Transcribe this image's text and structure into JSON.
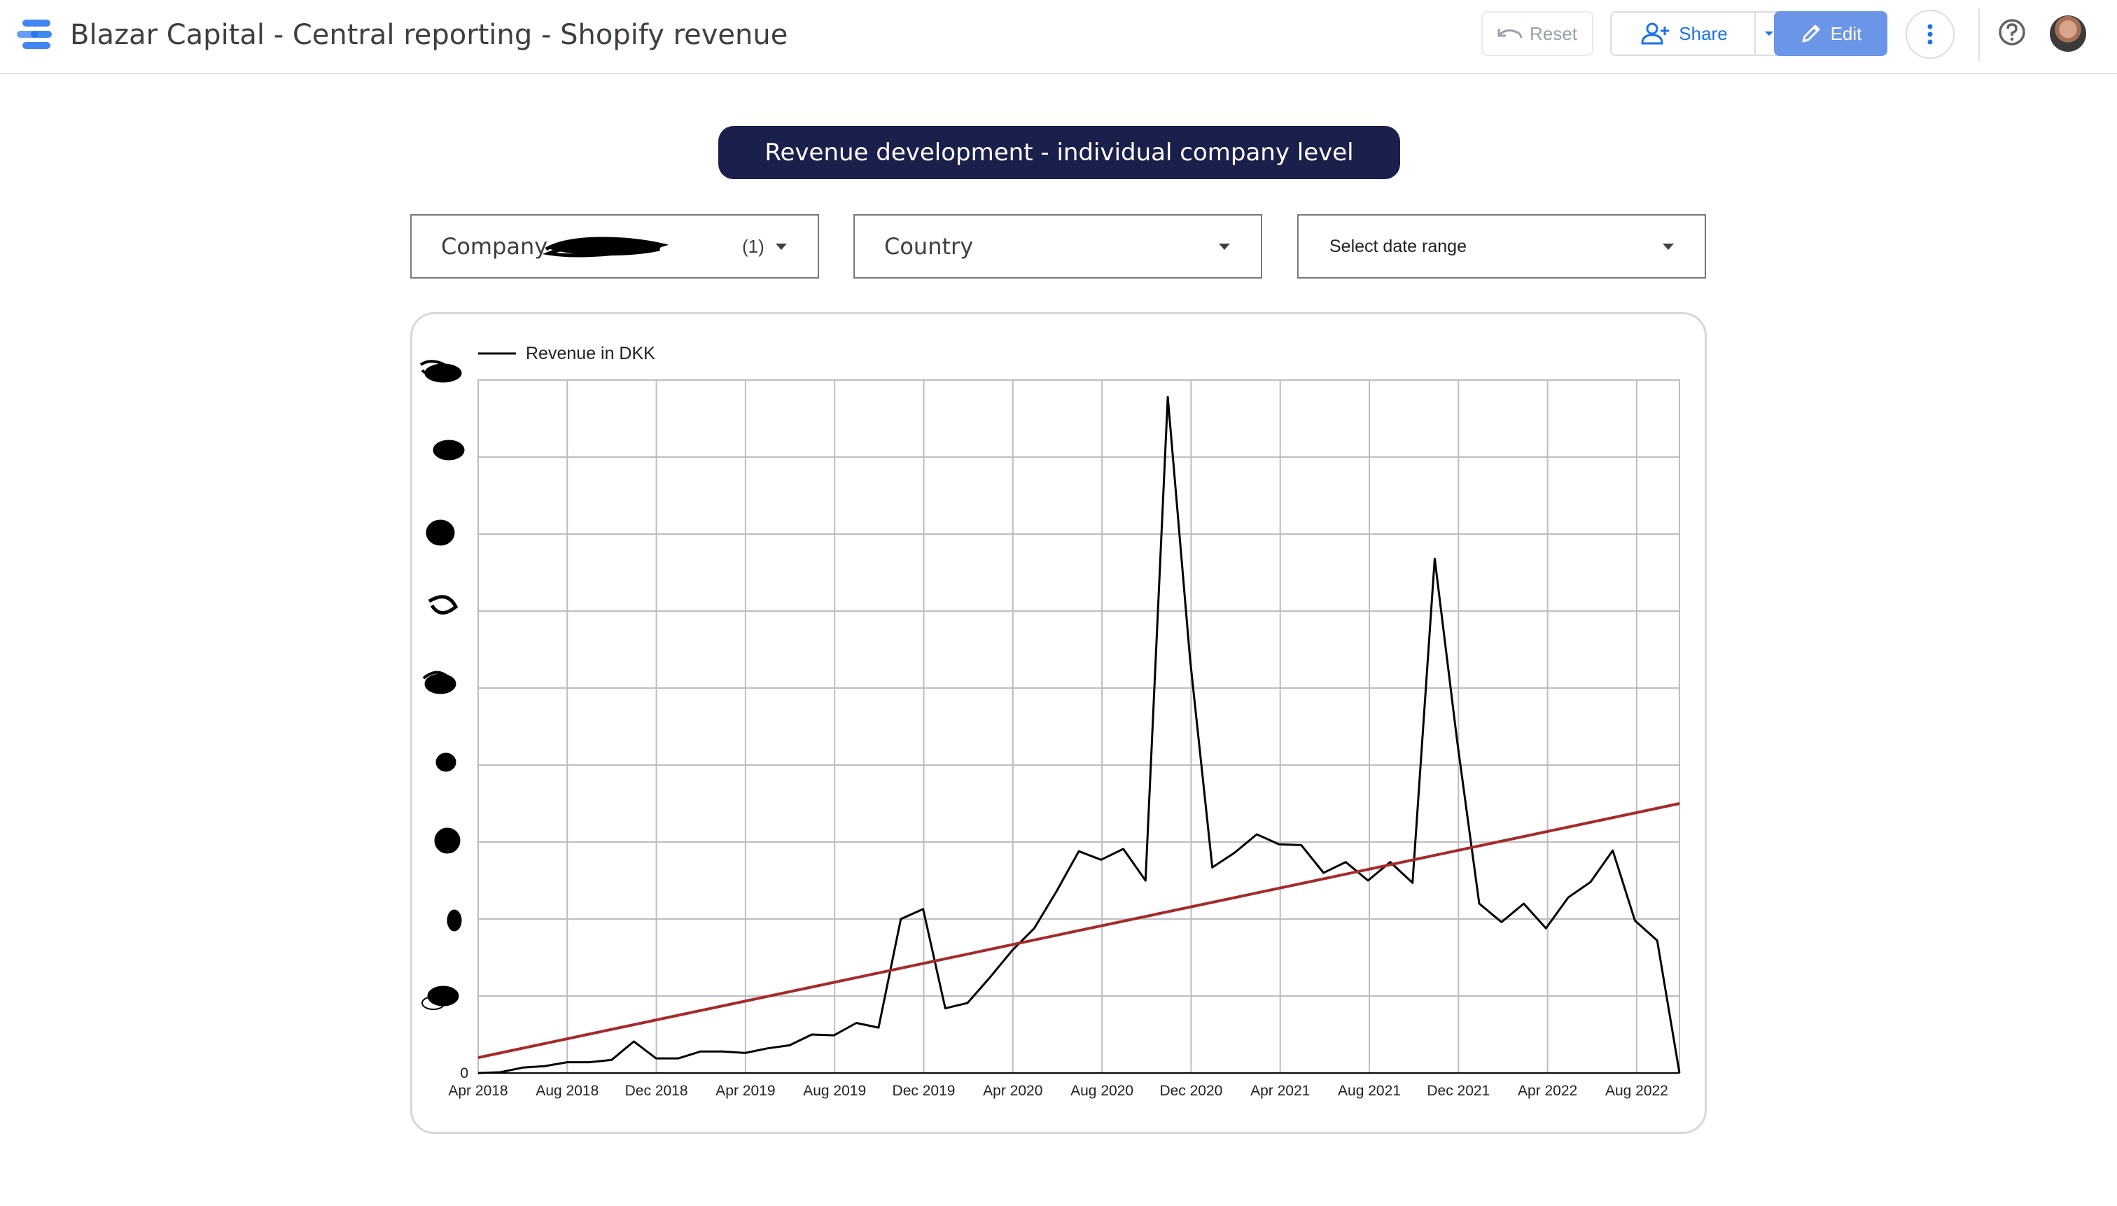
{
  "app": {
    "title": "Blazar Capital - Central reporting - Shopify revenue"
  },
  "toolbar": {
    "reset_label": "Reset",
    "share_label": "Share",
    "edit_label": "Edit",
    "accent_color": "#6b95e6",
    "share_color": "#1a73e8"
  },
  "report": {
    "header": "Revenue development - individual company level"
  },
  "filters": {
    "company": {
      "label": "Company",
      "count": "(1)"
    },
    "country": {
      "label": "Country"
    },
    "date": {
      "label": "Select date range"
    }
  },
  "chart_data": {
    "type": "line",
    "series": [
      {
        "name": "Revenue in DKK",
        "color": "#000000",
        "values": [
          0.0,
          0.01,
          0.07,
          0.09,
          0.14,
          0.14,
          0.17,
          0.41,
          0.19,
          0.19,
          0.28,
          0.28,
          0.26,
          0.32,
          0.36,
          0.5,
          0.49,
          0.65,
          0.59,
          2.0,
          2.13,
          0.84,
          0.91,
          1.24,
          1.59,
          1.88,
          2.36,
          2.88,
          2.77,
          2.91,
          2.5,
          8.78,
          5.38,
          2.67,
          2.86,
          3.1,
          2.97,
          2.96,
          2.6,
          2.74,
          2.5,
          2.74,
          2.47,
          6.68,
          4.33,
          2.2,
          1.96,
          2.2,
          1.88,
          2.28,
          2.48,
          2.89,
          1.98,
          1.72,
          0.0
        ]
      },
      {
        "name": "",
        "color": "#a52a2a",
        "values": [
          0.2,
          3.5
        ]
      }
    ],
    "x_ticks": [
      "Apr 2018",
      "Aug 2018",
      "Dec 2018",
      "Apr 2019",
      "Aug 2019",
      "Dec 2019",
      "Apr 2020",
      "Aug 2020",
      "Dec 2020",
      "Apr 2021",
      "Aug 2021",
      "Dec 2021",
      "Apr 2022",
      "Aug 2022"
    ],
    "y_ticks": [
      "0"
    ],
    "ylim": [
      0,
      9
    ],
    "grid": true,
    "legend": "top-left",
    "xlabel": "",
    "ylabel": ""
  }
}
